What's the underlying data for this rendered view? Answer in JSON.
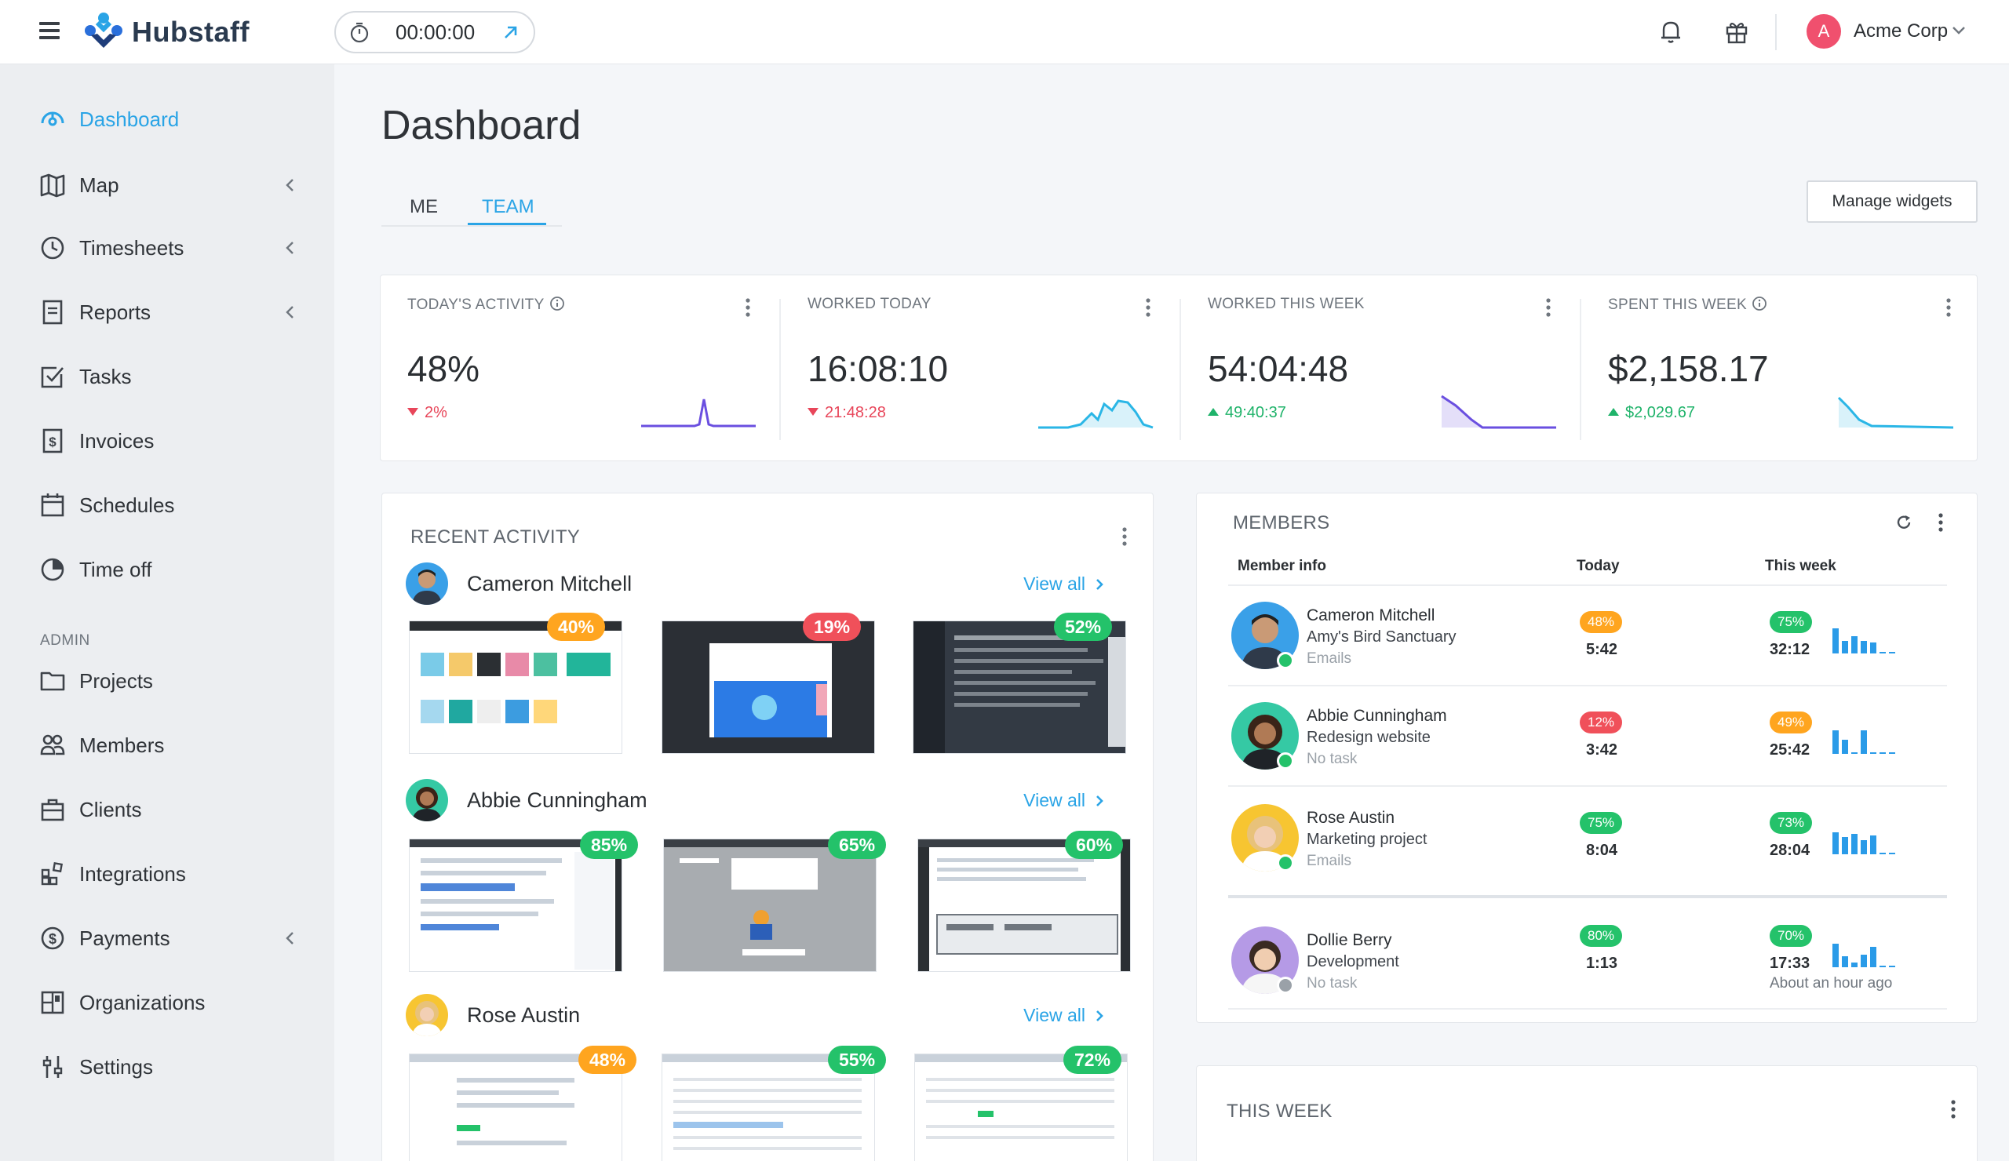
{
  "app": {
    "brand": "Hubstaff",
    "timer": "00:00:00",
    "org_name": "Acme Corp",
    "org_initial": "A",
    "accent": "#2aa4e6"
  },
  "sidebar": {
    "items": [
      {
        "label": "Dashboard",
        "icon": "dashboard-icon",
        "active": true
      },
      {
        "label": "Map",
        "icon": "map-icon",
        "has_submenu": true
      },
      {
        "label": "Timesheets",
        "icon": "clock-icon",
        "has_submenu": true
      },
      {
        "label": "Reports",
        "icon": "report-icon",
        "has_submenu": true
      },
      {
        "label": "Tasks",
        "icon": "checkbox-icon"
      },
      {
        "label": "Invoices",
        "icon": "invoice-icon"
      },
      {
        "label": "Schedules",
        "icon": "calendar-icon"
      },
      {
        "label": "Time off",
        "icon": "pie-icon"
      }
    ],
    "admin_section": "ADMIN",
    "admin_items": [
      {
        "label": "Projects",
        "icon": "folder-icon"
      },
      {
        "label": "Members",
        "icon": "members-icon"
      },
      {
        "label": "Clients",
        "icon": "briefcase-icon"
      },
      {
        "label": "Integrations",
        "icon": "integrations-icon"
      },
      {
        "label": "Payments",
        "icon": "dollar-circle-icon",
        "has_submenu": true
      },
      {
        "label": "Organizations",
        "icon": "organizations-icon"
      },
      {
        "label": "Settings",
        "icon": "settings-sliders-icon"
      }
    ]
  },
  "main": {
    "title": "Dashboard",
    "tabs": [
      {
        "label": "ME"
      },
      {
        "label": "TEAM",
        "active": true
      }
    ],
    "manage_widgets": "Manage widgets"
  },
  "stats": [
    {
      "title": "TODAY'S ACTIVITY",
      "has_info": true,
      "value": "48%",
      "delta": "2%",
      "direction": "down",
      "spark_color": "#6a4fe0"
    },
    {
      "title": "WORKED TODAY",
      "has_info": false,
      "value": "16:08:10",
      "delta": "21:48:28",
      "direction": "down",
      "spark_color": "#2ab6e6"
    },
    {
      "title": "WORKED THIS WEEK",
      "has_info": false,
      "value": "54:04:48",
      "delta": "49:40:37",
      "direction": "up",
      "spark_color": "#6a4fe0"
    },
    {
      "title": "SPENT THIS WEEK",
      "has_info": true,
      "value": "$2,158.17",
      "delta": "$2,029.67",
      "direction": "up",
      "spark_color": "#2ab6e6"
    }
  ],
  "recent_activity": {
    "title": "RECENT ACTIVITY",
    "view_all": "View all",
    "people": [
      {
        "name": "Cameron Mitchell",
        "shots": [
          {
            "pct": "40%",
            "level": "orange"
          },
          {
            "pct": "19%",
            "level": "red"
          },
          {
            "pct": "52%",
            "level": "green"
          }
        ]
      },
      {
        "name": "Abbie Cunningham",
        "shots": [
          {
            "pct": "85%",
            "level": "green"
          },
          {
            "pct": "65%",
            "level": "green"
          },
          {
            "pct": "60%",
            "level": "green"
          }
        ]
      },
      {
        "name": "Rose Austin",
        "shots": [
          {
            "pct": "48%",
            "level": "orange"
          },
          {
            "pct": "55%",
            "level": "green"
          },
          {
            "pct": "72%",
            "level": "green"
          }
        ]
      }
    ]
  },
  "members": {
    "title": "MEMBERS",
    "columns": {
      "info": "Member info",
      "today": "Today",
      "week": "This week"
    },
    "rows": [
      {
        "name": "Cameron Mitchell",
        "project": "Amy's Bird Sanctuary",
        "task": "Emails",
        "online": true,
        "today_pct": "48%",
        "today_level": "orange",
        "today_time": "5:42",
        "week_pct": "75%",
        "week_level": "green",
        "week_time": "32:12",
        "note": ""
      },
      {
        "name": "Abbie Cunningham",
        "project": "Redesign website",
        "task": "No task",
        "online": true,
        "today_pct": "12%",
        "today_level": "red",
        "today_time": "3:42",
        "week_pct": "49%",
        "week_level": "orange",
        "week_time": "25:42",
        "note": ""
      },
      {
        "name": "Rose Austin",
        "project": "Marketing project",
        "task": "Emails",
        "online": true,
        "today_pct": "75%",
        "today_level": "green",
        "today_time": "8:04",
        "week_pct": "73%",
        "week_level": "green",
        "week_time": "28:04",
        "note": ""
      },
      {
        "name": "Dollie Berry",
        "project": "Development",
        "task": "No task",
        "online": false,
        "today_pct": "80%",
        "today_level": "green",
        "today_time": "1:13",
        "week_pct": "70%",
        "week_level": "green",
        "week_time": "17:33",
        "note": "About an hour ago"
      }
    ]
  },
  "this_week": {
    "title": "THIS WEEK"
  }
}
